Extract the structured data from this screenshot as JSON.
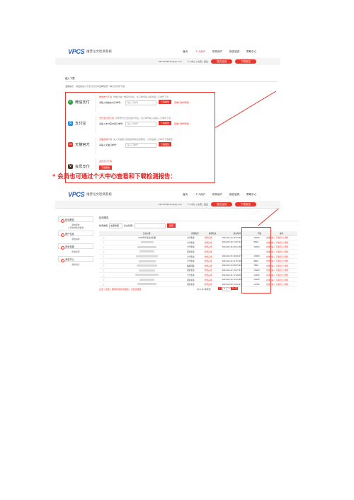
{
  "shot1": {
    "logo": "VPCS",
    "logo_sub": "维普论文检测系统",
    "nav": [
      "首页",
      "个人用户",
      "机构用户",
      "报告验真",
      "帮助中心"
    ],
    "nav_active_index": 1,
    "user_email": "8870788431@qq.com",
    "user_links": "个人中心 | 充值 | 退出",
    "submit_button": "提交检测",
    "download_button": "下载报告",
    "section_title": "缩入下载",
    "notice": "温馨提示：请直接在以下支付方式中选择任意一种方式付款下载",
    "methods": [
      {
        "name": "微信支付",
        "icon": "wechat-icon",
        "color": "#29a33a",
        "headline": "微信支付下载",
        "desc": "微信扫描二维码付款后，在订单号输入框中输入订单号下载",
        "field_label": "请输入微信支付订单号：",
        "field_value": "输入订单号",
        "btn": "下载报告",
        "help": "查看订单号帮助"
      },
      {
        "name": "支付宝",
        "icon": "alipay-icon",
        "color": "#1a8fe0",
        "headline": "支付宝付款下载",
        "desc": "请登录支付宝扫描付款后，在订单号输入框输入订单号下载",
        "field_label": "请输入支付宝交易订单号：",
        "field_value": "输入订单号",
        "btn": "下载报告",
        "help": "查看订单号帮助"
      },
      {
        "name": "天猫官方",
        "icon": "tmall-icon",
        "color": "#e83a2f",
        "headline": "天猫店铺下载",
        "desc": "进入天猫官方旗舰店购买检测服务，付款后输入订单号下载报告",
        "field_label": "请输入天猫订单号：",
        "field_value": "输入订单号",
        "btn": "下载报告",
        "help": ""
      },
      {
        "name": "会员支付",
        "icon": "member-icon",
        "color": "#4a3b2a",
        "headline": "会员支付下载",
        "desc": "",
        "field_label": "",
        "field_value": "",
        "btn": "下载报告",
        "help": "会员可直接下载报告"
      }
    ]
  },
  "caption": "* 会员也可通过个人中心查看和下载检测报告：",
  "shot2": {
    "logo": "VPCS",
    "logo_sub": "维普论文检测系统",
    "nav": [
      "首页",
      "个人用户",
      "机构用户",
      "报告验真",
      "帮助中心"
    ],
    "user_email": "8870788431@qq.com",
    "user_links": "个人中心 | 充值 | 退出",
    "submit_button": "提交检测",
    "download_button": "下载报告",
    "sidebar": [
      {
        "label": "检测报告",
        "sub": [
          "我的报告",
          "上传文献检测报告"
        ]
      },
      {
        "label": "账户信息",
        "sub": [
          "我的资料"
        ]
      },
      {
        "label": "安全设置",
        "sub": [
          "修改密码"
        ]
      },
      {
        "label": "消息中心",
        "sub": [
          "我的消息"
        ]
      }
    ],
    "panel_title": "检测报告",
    "filter_label": "检测类型：",
    "filter_value": "全部类型",
    "search_label": "论文标题：",
    "search_button": "搜索",
    "columns": [
      "",
      "论文标题",
      "检测类型",
      "检测状态",
      "提交时间",
      "字数",
      "操作"
    ],
    "rows": [
      {
        "title": "2019年毕业论文初稿",
        "type": "大学生版",
        "status": "检测完成",
        "time": "2019-04-19 16:23:30",
        "words": "12000"
      },
      {
        "title": "",
        "type": "大学生版",
        "status": "检测完成",
        "time": "2019-04-18 14:45:21",
        "words": "8500"
      },
      {
        "title": "",
        "type": "大学生版",
        "status": "检测完成",
        "time": "2019-04-16 09:12:48",
        "words": "10200"
      },
      {
        "title": "",
        "type": "研究生版",
        "status": "检测完成",
        "time": "",
        "words": ""
      },
      {
        "title": "",
        "type": "大学生版",
        "status": "检测完成",
        "time": "2019-04-15 20:06:17",
        "words": "13400"
      },
      {
        "title": "",
        "type": "大学生版",
        "status": "检测完成",
        "time": "2019-04-14 11:51:09",
        "words": "9600"
      },
      {
        "title": "",
        "type": "编辑部版",
        "status": "检测完成",
        "time": "2019-04-13 08:35:42",
        "words": "7800"
      },
      {
        "title": "",
        "type": "研究生版",
        "status": "检测完成",
        "time": "2019-04-12 15:27:33",
        "words": "15100"
      },
      {
        "title": "",
        "type": "大学生版",
        "status": "检测完成",
        "time": "2019-04-11 17:48:05",
        "words": "11300"
      },
      {
        "title": "",
        "type": "研究生版",
        "status": "检测完成",
        "time": "2019-04-10 10:19:56",
        "words": "14200"
      },
      {
        "title": "",
        "type": "研究生版",
        "status": "检测完成",
        "time": "2019-04-09 13:02:27",
        "words": "12700"
      }
    ],
    "row_ops": "在线查看 | 下载报告 | 删除",
    "footer_note": "全选 | 批量 | 删除所选检测报告 | 已检测报告",
    "pagination": [
      "1",
      "2",
      "3",
      "下一页"
    ],
    "page_info": "共11条 跳转至"
  }
}
